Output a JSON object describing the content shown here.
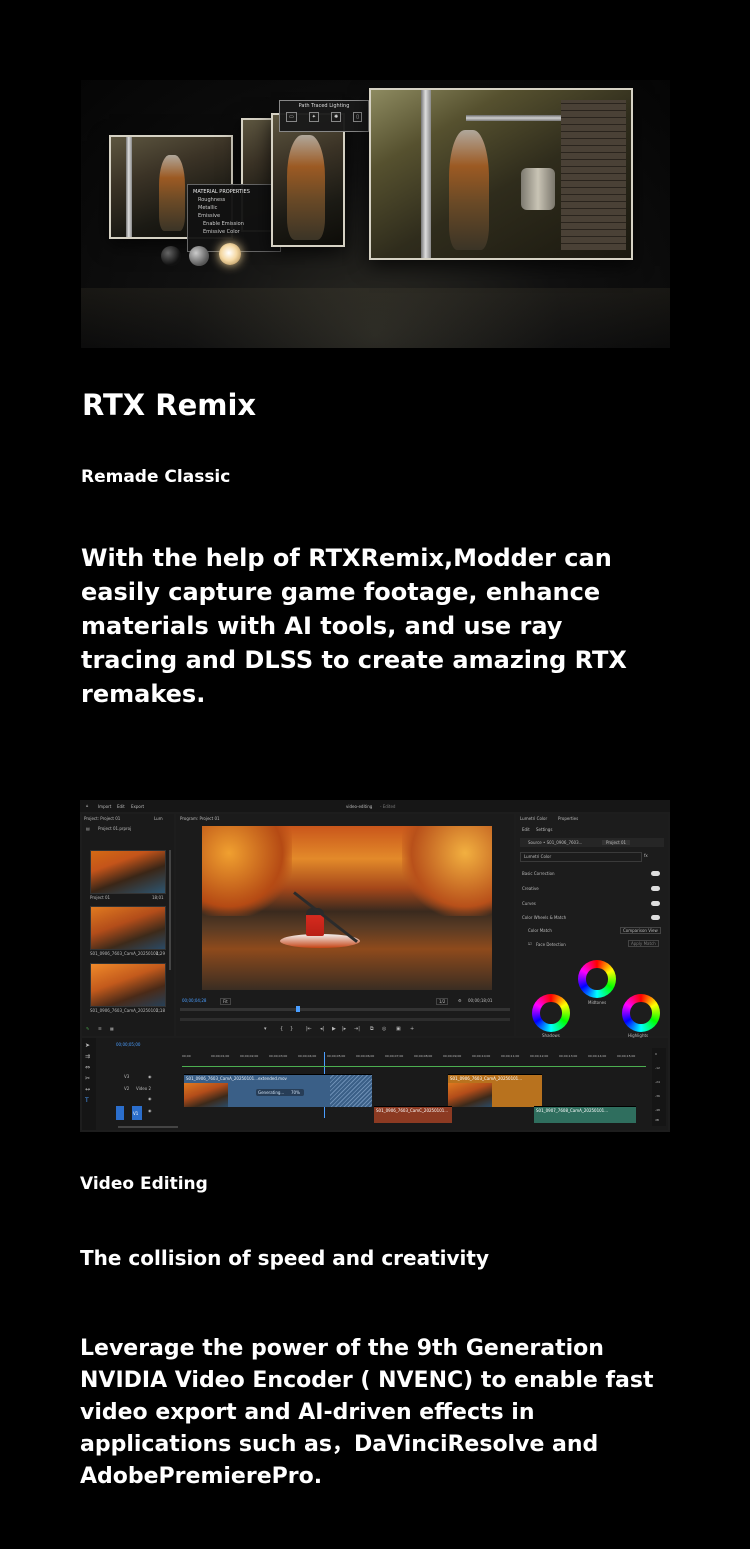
{
  "section1": {
    "title": "RTX Remix",
    "subtitle": "Remade Classic",
    "description": "With the help of RTXRemix,Modder can easily capture game footage, enhance materials with AI tools, and use ray tracing and DLSS to create amazing RTX remakes.",
    "hero": {
      "material_panel": {
        "title": "MATERIAL PROPERTIES",
        "items": [
          "Roughness",
          "Metallic",
          "Emissive",
          "Enable Emission",
          "Emissive Color"
        ]
      },
      "lighting_panel": {
        "title": "Path Traced Lighting",
        "items": [
          "Cylinder",
          "Disk",
          "Distant",
          "Rect"
        ]
      }
    }
  },
  "section2": {
    "editor": {
      "menu": [
        "Import",
        "Edit",
        "Export"
      ],
      "window_title": "video-editing",
      "window_status": "- Edited",
      "project_tab": "Project: Project 01",
      "lumetri_tab": "Lum",
      "program_tab": "Program: Project 01",
      "project_file": "Project 01.prproj",
      "clips": [
        {
          "name": "Project 01",
          "duration": "18;01"
        },
        {
          "name": "S01_0906_7603_CamA_20250101...",
          "duration": "4;29"
        },
        {
          "name": "S01_0906_7603_CamA_20250101...",
          "duration": "2;18"
        }
      ],
      "program_timecode": "00;00;04;28",
      "fit": "Fit",
      "quality": "1/2",
      "duration_timecode": "00;00;18;01",
      "lumetri": {
        "tabs": [
          "Lumetri Color",
          "Properties"
        ],
        "subtabs": [
          "Edit",
          "Settings"
        ],
        "source": "Source • S01_0906_7603...",
        "target": "Project 01",
        "effect": "Lumetri Color",
        "sections": [
          "Basic Correction",
          "Creative",
          "Curves",
          "Color Wheels & Match"
        ],
        "color_match": "Color Match",
        "comparison_view": "Comparison View",
        "face_detection": "Face Detection",
        "apply_match": "Apply Match",
        "wheels": [
          "Midtones",
          "Shadows",
          "Highlights"
        ]
      },
      "timeline": {
        "timecode": "00;00;05;00",
        "ruler": [
          "00;00",
          "00;00;01;00",
          "00;00;02;00",
          "00;00;03;00",
          "00;00;04;00",
          "00;00;05;00",
          "00;00;06;00",
          "00;00;07;00",
          "00;00;08;00",
          "00;00;09;00",
          "00;00;10;00",
          "00;00;11;00",
          "00;00;12;00",
          "00;00;13;00",
          "00;00;14;00",
          "00;00;15;00"
        ],
        "tracks": [
          "V3",
          "V2",
          "Video 2",
          "V1"
        ],
        "v2_clip": "S01_0906_7603_CamA_20250101...extended.mov",
        "generating": "Generating...",
        "generating_pct": "70%",
        "v2_clip2": "S01_0906_7603_CamA_20250101...",
        "v1_clip1": "S01_0906_7603_CamC_20250101...",
        "v1_clip2": "S01_0907_7608_CamA_20250101...",
        "meter": [
          "0",
          "-12",
          "-24",
          "-36",
          "-48",
          "dB"
        ]
      }
    },
    "title": "Video Editing",
    "subtitle": "The collision of speed and creativity",
    "description": "Leverage the power of the 9th Generation NVIDIA Video Encoder ( NVENC) to enable fast video export and AI-driven effects in applications such as，DaVinciResolve and AdobePremierePro."
  }
}
